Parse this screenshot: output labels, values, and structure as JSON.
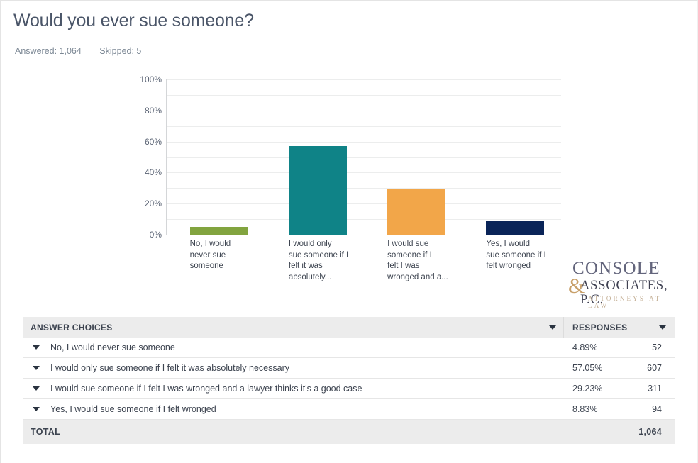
{
  "header": {
    "question_title": "Would you ever sue someone?",
    "answered_label": "Answered: 1,064",
    "skipped_label": "Skipped: 5"
  },
  "chart_data": {
    "type": "bar",
    "title": "Would you ever sue someone?",
    "xlabel": "",
    "ylabel": "",
    "ylim": [
      0,
      100
    ],
    "ytick_labels": [
      "0%",
      "20%",
      "40%",
      "60%",
      "80%",
      "100%"
    ],
    "ytick_values": [
      0,
      20,
      40,
      60,
      80,
      100
    ],
    "grid": true,
    "grid_minor_step": 10,
    "legend": "none",
    "categories": [
      "No, I would never sue someone",
      "I would only sue someone if I felt it was absolutely...",
      "I would sue someone if I felt I was wronged and a...",
      "Yes, I would sue someone if I felt wronged"
    ],
    "category_display_lines": [
      [
        "No, I would",
        "never sue",
        "someone"
      ],
      [
        "I would only",
        "sue someone if I",
        "felt it was",
        "absolutely..."
      ],
      [
        "I would sue",
        "someone if I",
        "felt I was",
        "wronged and a..."
      ],
      [
        "Yes, I would",
        "sue someone if I",
        "felt wronged"
      ]
    ],
    "values": [
      4.89,
      57.05,
      29.23,
      8.83
    ],
    "counts": [
      52,
      607,
      311,
      94
    ],
    "colors": [
      "#82A43F",
      "#0F8387",
      "#F2A649",
      "#0A2458"
    ]
  },
  "logo": {
    "line1": "CONSOLE",
    "ampersand": "&",
    "line2": "ASSOCIATES, P.C.",
    "tagline": "ATTORNEYS AT LAW"
  },
  "table": {
    "headers": {
      "answer_choices": "ANSWER CHOICES",
      "responses": "RESPONSES"
    },
    "rows": [
      {
        "choice": "No, I would never sue someone",
        "percent": "4.89%",
        "count": "52"
      },
      {
        "choice": "I would only sue someone if I felt it was absolutely necessary",
        "percent": "57.05%",
        "count": "607"
      },
      {
        "choice": "I would sue someone if I felt I was wronged and a lawyer thinks it's a good case",
        "percent": "29.23%",
        "count": "311"
      },
      {
        "choice": "Yes, I would sue someone if I felt wronged",
        "percent": "8.83%",
        "count": "94"
      }
    ],
    "total": {
      "label": "TOTAL",
      "percent": "",
      "count": "1,064"
    }
  }
}
